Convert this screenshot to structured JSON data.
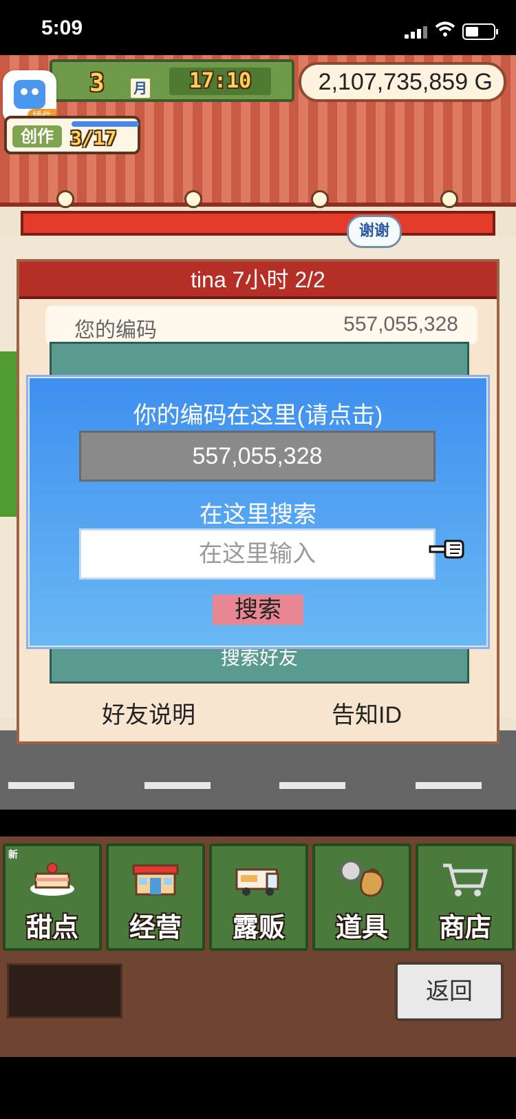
{
  "status_bar": {
    "time": "5:09"
  },
  "hud": {
    "month": "3",
    "month_unit": "月",
    "clock": "17:10",
    "gold": "2,107,735,859 G",
    "create_label": "创作",
    "create_count": "3/17"
  },
  "plugin": {
    "tag": "插件"
  },
  "friend_panel": {
    "title": "tina  7小时 2/2",
    "code_label": "您的编码",
    "code_value": "557,055,328",
    "search_friend_label": "搜索好友",
    "thanks_label": "谢谢",
    "left_link": "好友说明",
    "right_link": "告知ID"
  },
  "dialog": {
    "title": "你的编码在这里(请点击)",
    "code_value": "557,055,328",
    "search_here": "在这里搜索",
    "input_placeholder": "在这里输入",
    "search_button": "搜索"
  },
  "menu": {
    "new_tag": "新",
    "items": [
      {
        "label": "甜点",
        "icon": "cake-icon"
      },
      {
        "label": "经营",
        "icon": "shop-icon"
      },
      {
        "label": "露贩",
        "icon": "food-truck-icon"
      },
      {
        "label": "道具",
        "icon": "item-bag-icon"
      },
      {
        "label": "商店",
        "icon": "cart-icon"
      }
    ],
    "back_label": "返回"
  }
}
